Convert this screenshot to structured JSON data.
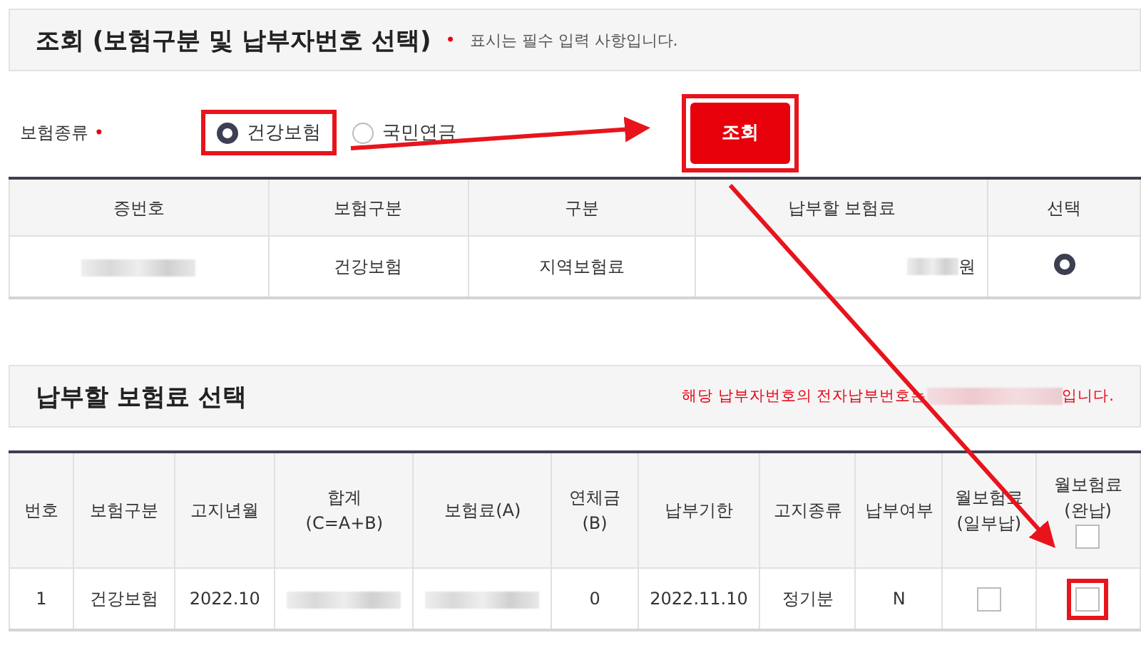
{
  "search_section": {
    "title": "조회 (보험구분 및 납부자번호 선택)",
    "required_mark": "•",
    "required_note": "표시는 필수 입력 사항입니다."
  },
  "form": {
    "label": "보험종류",
    "required_mark": "•",
    "radios": [
      {
        "label": "건강보험",
        "selected": true,
        "highlighted": true
      },
      {
        "label": "국민연금",
        "selected": false,
        "highlighted": false
      }
    ],
    "button": {
      "label": "조회",
      "highlighted": true
    }
  },
  "payer_table": {
    "columns": [
      "증번호",
      "보험구분",
      "구분",
      "납부할 보험료",
      "선택"
    ],
    "rows": [
      {
        "cells": [
          {
            "kind": "blurred"
          },
          {
            "kind": "text",
            "text": "건강보험"
          },
          {
            "kind": "text",
            "text": "지역보험료"
          },
          {
            "kind": "blurred",
            "suffix": "원"
          },
          {
            "kind": "radio",
            "selected": true
          }
        ]
      }
    ]
  },
  "premium_section": {
    "title": "납부할 보험료 선택",
    "note_before": "해당 납부자번호의 전자납부번호는",
    "note_after": "입니다."
  },
  "premium_table": {
    "columns": [
      {
        "lines": [
          "번호"
        ]
      },
      {
        "lines": [
          "보험구분"
        ]
      },
      {
        "lines": [
          "고지년월"
        ]
      },
      {
        "lines": [
          "합계",
          "(C=A+B)"
        ]
      },
      {
        "lines": [
          "보험료(A)"
        ]
      },
      {
        "lines": [
          "연체금(B)"
        ]
      },
      {
        "lines": [
          "납부기한"
        ]
      },
      {
        "lines": [
          "고지종류"
        ]
      },
      {
        "lines": [
          "납부여부"
        ]
      },
      {
        "lines": [
          "월보험료",
          "(일부납)"
        ]
      },
      {
        "lines": [
          "월보험료",
          "(완납)"
        ],
        "checkbox": {
          "checked": false
        }
      }
    ],
    "rows": [
      {
        "cells": [
          {
            "kind": "text",
            "text": "1"
          },
          {
            "kind": "text",
            "text": "건강보험"
          },
          {
            "kind": "text",
            "text": "2022.10"
          },
          {
            "kind": "blurred"
          },
          {
            "kind": "blurred"
          },
          {
            "kind": "text",
            "text": "0"
          },
          {
            "kind": "text",
            "text": "2022.11.10"
          },
          {
            "kind": "text",
            "text": "정기분"
          },
          {
            "kind": "text",
            "text": "N"
          },
          {
            "kind": "checkbox",
            "checked": false,
            "highlighted": false
          },
          {
            "kind": "checkbox",
            "checked": false,
            "highlighted": true
          }
        ]
      }
    ]
  }
}
